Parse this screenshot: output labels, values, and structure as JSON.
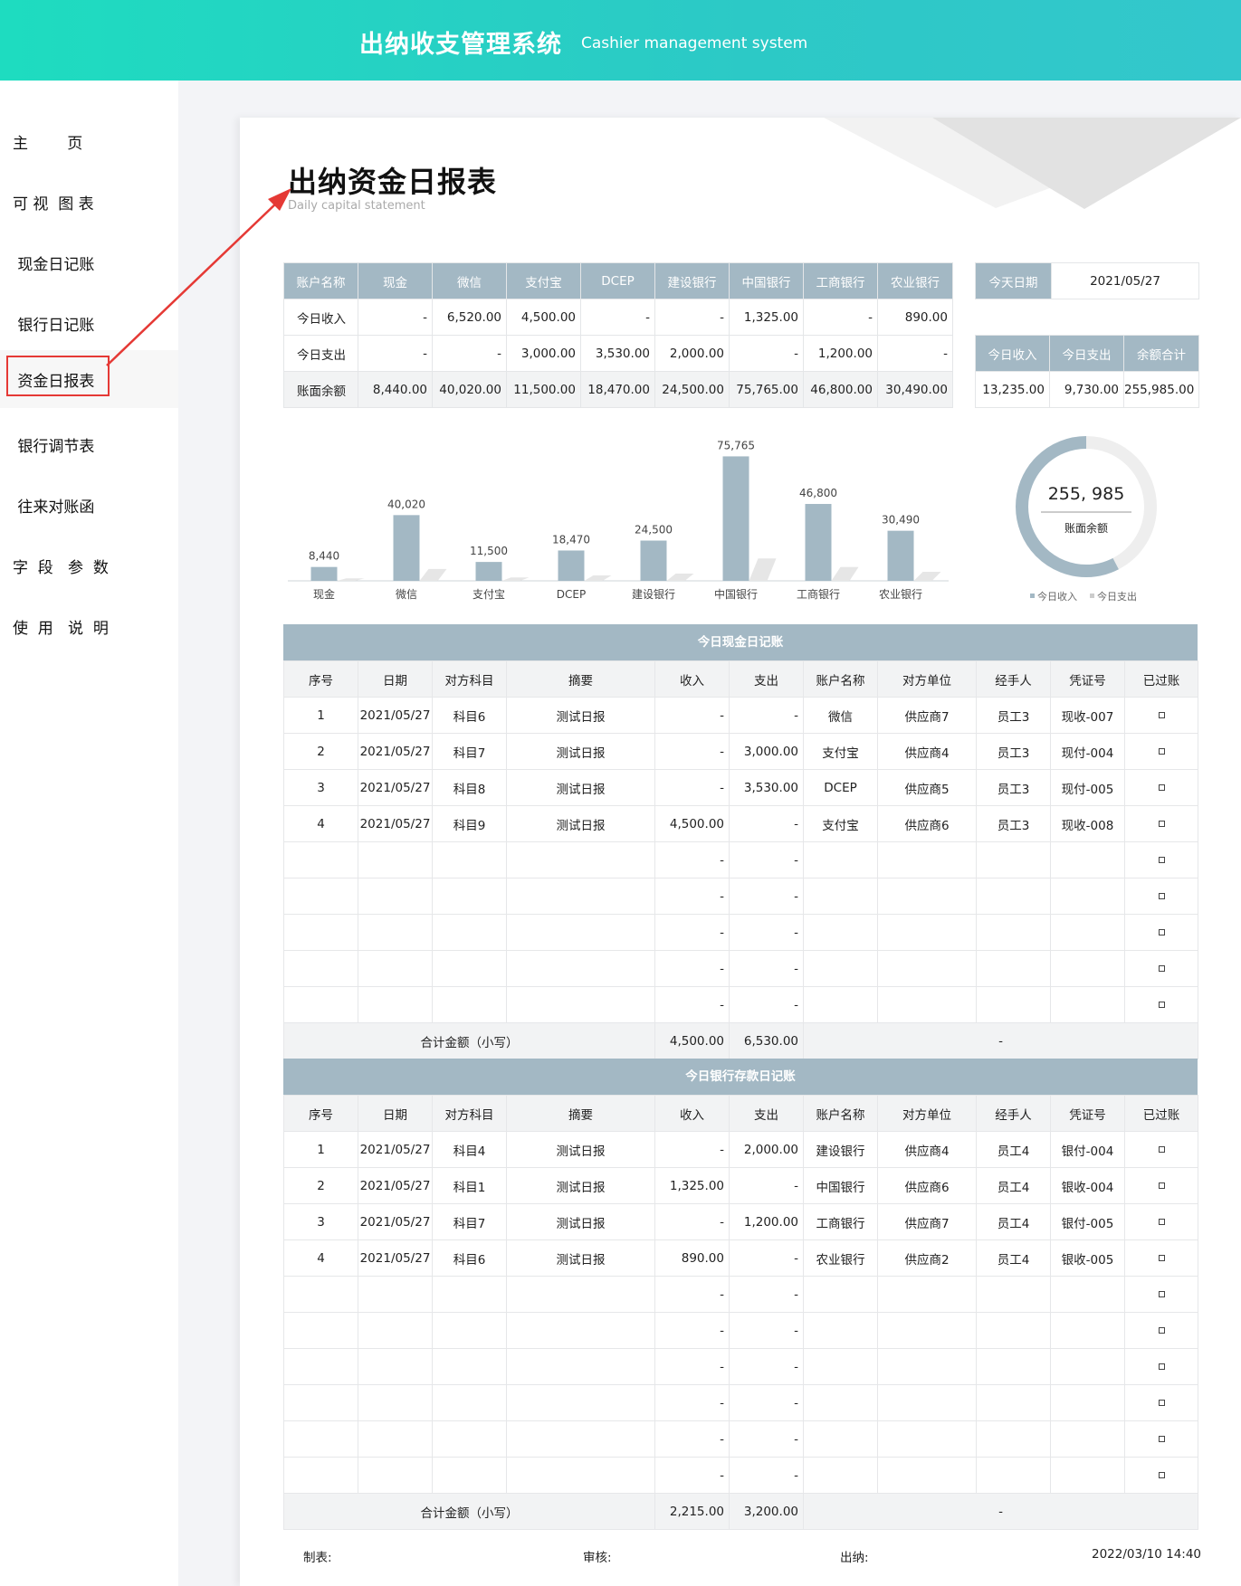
{
  "header": {
    "title": "出纳收支管理系统",
    "subtitle": "Cashier management system"
  },
  "sidebar": {
    "items": [
      {
        "label": "主        页"
      },
      {
        "label": "可 视  图 表"
      },
      {
        "label": " 现金日记账"
      },
      {
        "label": " 银行日记账"
      },
      {
        "label": " 资金日报表"
      },
      {
        "label": " 银行调节表"
      },
      {
        "label": " 往来对账函"
      },
      {
        "label": "字  段   参  数"
      },
      {
        "label": "使  用   说  明"
      }
    ],
    "active_index": 4
  },
  "page": {
    "title": "出纳资金日报表",
    "subtitle": "Daily capital statement"
  },
  "summary": {
    "headers": [
      "账户名称",
      "现金",
      "微信",
      "支付宝",
      "DCEP",
      "建设银行",
      "中国银行",
      "工商银行",
      "农业银行"
    ],
    "rows": [
      [
        "今日收入",
        "-",
        "6,520.00",
        "4,500.00",
        "-",
        "-",
        "1,325.00",
        "-",
        "890.00"
      ],
      [
        "今日支出",
        "-",
        "-",
        "3,000.00",
        "3,530.00",
        "2,000.00",
        "-",
        "1,200.00",
        "-"
      ],
      [
        "账面余额",
        "8,440.00",
        "40,020.00",
        "11,500.00",
        "18,470.00",
        "24,500.00",
        "75,765.00",
        "46,800.00",
        "30,490.00"
      ]
    ]
  },
  "today": {
    "label": "今天日期",
    "value": "2021/05/27"
  },
  "totals": {
    "headers": [
      "今日收入",
      "今日支出",
      "余额合计"
    ],
    "values": [
      "13,235.00",
      "9,730.00",
      "255,985.00"
    ]
  },
  "chart_data": [
    {
      "type": "bar",
      "categories": [
        "现金",
        "微信",
        "支付宝",
        "DCEP",
        "建设银行",
        "中国银行",
        "工商银行",
        "农业银行"
      ],
      "values": [
        8440,
        40020,
        11500,
        18470,
        24500,
        75765,
        46800,
        30490
      ],
      "data_labels": [
        "8,440",
        "40,020",
        "11,500",
        "18,470",
        "24,500",
        "75,765",
        "46,800",
        "30,490"
      ],
      "color": "#a3b8c4"
    },
    {
      "type": "pie",
      "center_value": "255, 985",
      "center_label": "账面余额",
      "legend": [
        "今日收入",
        "今日支出"
      ],
      "values": [
        13235,
        9730
      ],
      "colors": [
        "#a3b8c4",
        "#eeeeee"
      ]
    }
  ],
  "cash_ledger": {
    "title": "今日现金日记账",
    "columns": [
      "序号",
      "日期",
      "对方科目",
      "摘要",
      "收入",
      "支出",
      "账户名称",
      "对方单位",
      "经手人",
      "凭证号",
      "已过账"
    ],
    "rows": [
      [
        "1",
        "2021/05/27",
        "科目6",
        "测试日报",
        "-",
        "-",
        "微信",
        "供应商7",
        "员工3",
        "现收-007"
      ],
      [
        "2",
        "2021/05/27",
        "科目7",
        "测试日报",
        "-",
        "3,000.00",
        "支付宝",
        "供应商4",
        "员工3",
        "现付-004"
      ],
      [
        "3",
        "2021/05/27",
        "科目8",
        "测试日报",
        "-",
        "3,530.00",
        "DCEP",
        "供应商5",
        "员工3",
        "现付-005"
      ],
      [
        "4",
        "2021/05/27",
        "科目9",
        "测试日报",
        "4,500.00",
        "-",
        "支付宝",
        "供应商6",
        "员工3",
        "现收-008"
      ],
      [
        "",
        "",
        "",
        "",
        "-",
        "-",
        "",
        "",
        "",
        ""
      ],
      [
        "",
        "",
        "",
        "",
        "-",
        "-",
        "",
        "",
        "",
        ""
      ],
      [
        "",
        "",
        "",
        "",
        "-",
        "-",
        "",
        "",
        "",
        ""
      ],
      [
        "",
        "",
        "",
        "",
        "-",
        "-",
        "",
        "",
        "",
        ""
      ],
      [
        "",
        "",
        "",
        "",
        "-",
        "-",
        "",
        "",
        "",
        ""
      ]
    ],
    "sum_label": "合计金额（小写）",
    "sum_income": "4,500.00",
    "sum_expense": "6,530.00",
    "sum_rest": "-"
  },
  "bank_ledger": {
    "title": "今日银行存款日记账",
    "columns": [
      "序号",
      "日期",
      "对方科目",
      "摘要",
      "收入",
      "支出",
      "账户名称",
      "对方单位",
      "经手人",
      "凭证号",
      "已过账"
    ],
    "rows": [
      [
        "1",
        "2021/05/27",
        "科目4",
        "测试日报",
        "-",
        "2,000.00",
        "建设银行",
        "供应商4",
        "员工4",
        "银付-004"
      ],
      [
        "2",
        "2021/05/27",
        "科目1",
        "测试日报",
        "1,325.00",
        "-",
        "中国银行",
        "供应商6",
        "员工4",
        "银收-004"
      ],
      [
        "3",
        "2021/05/27",
        "科目7",
        "测试日报",
        "-",
        "1,200.00",
        "工商银行",
        "供应商7",
        "员工4",
        "银付-005"
      ],
      [
        "4",
        "2021/05/27",
        "科目6",
        "测试日报",
        "890.00",
        "-",
        "农业银行",
        "供应商2",
        "员工4",
        "银收-005"
      ],
      [
        "",
        "",
        "",
        "",
        "-",
        "-",
        "",
        "",
        "",
        ""
      ],
      [
        "",
        "",
        "",
        "",
        "-",
        "-",
        "",
        "",
        "",
        ""
      ],
      [
        "",
        "",
        "",
        "",
        "-",
        "-",
        "",
        "",
        "",
        ""
      ],
      [
        "",
        "",
        "",
        "",
        "-",
        "-",
        "",
        "",
        "",
        ""
      ],
      [
        "",
        "",
        "",
        "",
        "-",
        "-",
        "",
        "",
        "",
        ""
      ],
      [
        "",
        "",
        "",
        "",
        "-",
        "-",
        "",
        "",
        "",
        ""
      ]
    ],
    "sum_label": "合计金额（小写）",
    "sum_income": "2,215.00",
    "sum_expense": "3,200.00",
    "sum_rest": "-"
  },
  "footer": {
    "maker": "制表:",
    "reviewer": "审核:",
    "cashier": "出纳:",
    "timestamp": "2022/03/10 14:40"
  }
}
